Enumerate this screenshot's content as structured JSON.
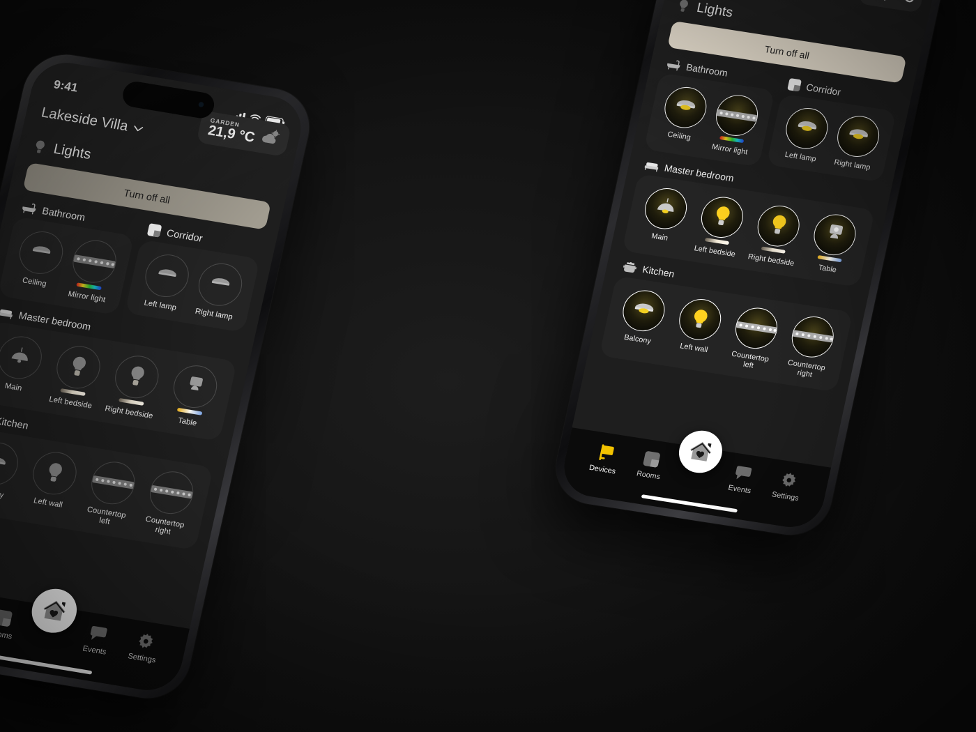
{
  "app": {
    "home_name": "Lakeside Villa",
    "section_title": "Lights",
    "turn_off_all": "Turn off all"
  },
  "status_bar": {
    "time": "9:41",
    "signal_icon": "cellular-bars-icon",
    "wifi_icon": "wifi-icon",
    "battery_icon": "battery-icon"
  },
  "weather": {
    "label": "GARDEN",
    "temperature": "21,9 °C",
    "icon": "partly-cloudy-icon"
  },
  "rooms": [
    {
      "name": "Bathroom",
      "icon": "bathtub-icon",
      "devices": [
        {
          "label": "Ceiling",
          "icon": "downlight-icon",
          "bar": "none"
        },
        {
          "label": "Mirror light",
          "icon": "led-strip-icon",
          "bar": "rgb"
        }
      ]
    },
    {
      "name": "Corridor",
      "icon": "corridor-icon",
      "devices": [
        {
          "label": "Left lamp",
          "icon": "downlight-icon",
          "bar": "none"
        },
        {
          "label": "Right lamp",
          "icon": "downlight-icon",
          "bar": "none"
        }
      ]
    },
    {
      "name": "Master bedroom",
      "icon": "bed-icon",
      "devices": [
        {
          "label": "Main",
          "icon": "pendant-lamp-icon",
          "bar": "none"
        },
        {
          "label": "Left bedside",
          "icon": "bulb-icon",
          "bar": "warm"
        },
        {
          "label": "Right bedside",
          "icon": "bulb-icon",
          "bar": "warm"
        },
        {
          "label": "Table",
          "icon": "table-lamp-icon",
          "bar": "tw"
        }
      ]
    },
    {
      "name": "Kitchen",
      "icon": "pot-icon",
      "devices": [
        {
          "label": "Balcony",
          "icon": "downlight-icon",
          "bar": "none"
        },
        {
          "label": "Left wall",
          "icon": "bulb-icon",
          "bar": "none"
        },
        {
          "label": "Countertop left",
          "icon": "led-strip-icon",
          "bar": "none"
        },
        {
          "label": "Countertop right",
          "icon": "led-strip-icon",
          "bar": "none"
        }
      ]
    }
  ],
  "tabbar": {
    "items": [
      {
        "label": "Devices",
        "icon": "wall-lamp-icon",
        "active": true
      },
      {
        "label": "Rooms",
        "icon": "rooms-icon",
        "active": false
      },
      {
        "label": "Events",
        "icon": "speech-bubble-icon",
        "active": false
      },
      {
        "label": "Settings",
        "icon": "gear-icon",
        "active": false
      }
    ],
    "home_button_icon": "house-heart-icon"
  },
  "colors": {
    "background": "#141414",
    "card": "#242424",
    "screen": "#1e1e1e",
    "accent_on": "#f7eedd",
    "accent_off": "#a19c90",
    "device_active": "#ffd21f",
    "tab_active": "#f2c200"
  },
  "phones": [
    {
      "id": "left",
      "state": "off",
      "shows_status_bar": true
    },
    {
      "id": "right",
      "state": "on",
      "shows_status_bar": false
    }
  ]
}
